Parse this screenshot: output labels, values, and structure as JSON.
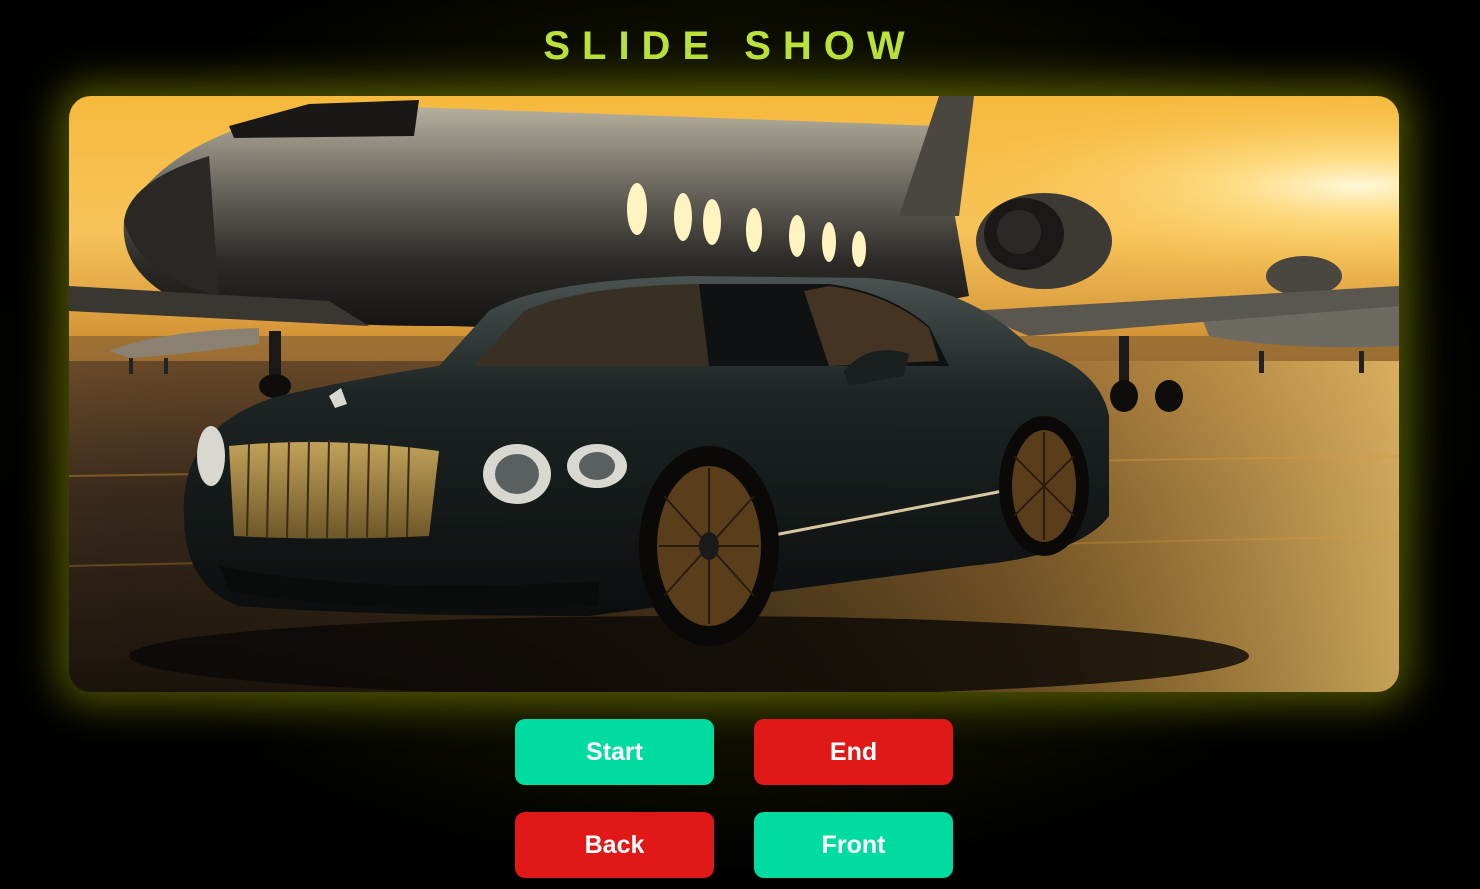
{
  "header": {
    "title": "SLIDE SHOW",
    "title_color": "#bbe33a"
  },
  "slide": {
    "image_icon": "car-and-jet-photo"
  },
  "controls": {
    "start_label": "Start",
    "end_label": "End",
    "back_label": "Back",
    "front_label": "Front"
  },
  "colors": {
    "background": "#000000",
    "glow": "#8c9600",
    "green_button": "#00dba0",
    "red_button": "#e01818",
    "button_text": "#ffffff"
  }
}
